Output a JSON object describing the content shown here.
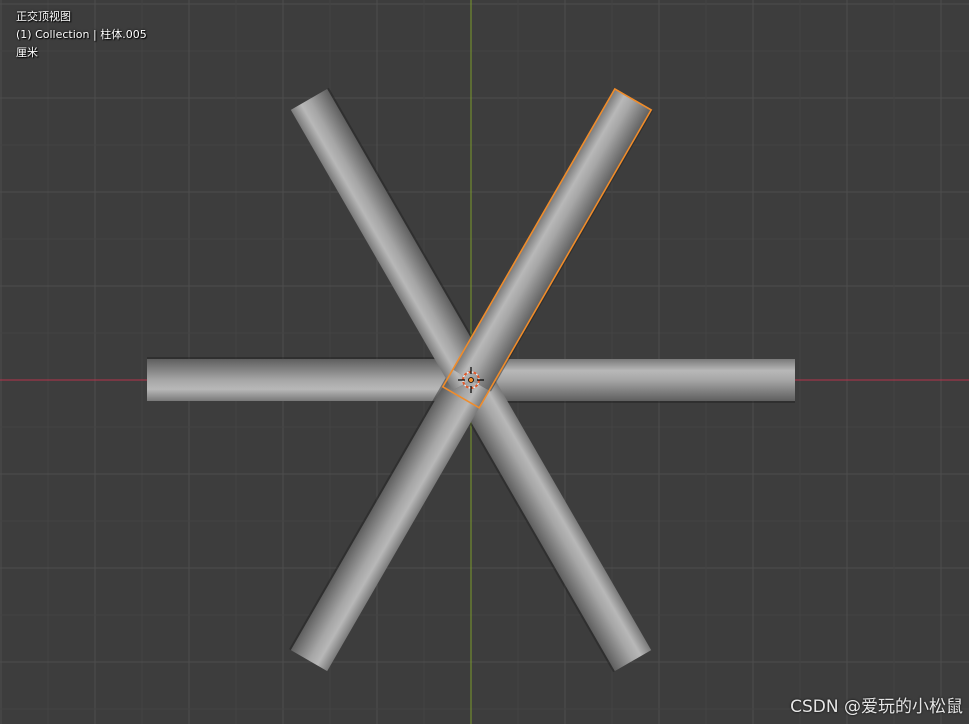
{
  "viewport": {
    "view_name": "正交顶视图",
    "collection_label": "(1) Collection",
    "separator": "|",
    "active_object": "柱体.005",
    "unit": "厘米"
  },
  "watermark": "CSDN @爱玩的小松鼠",
  "colors": {
    "background": "#3d3d3d",
    "grid_minor": "#444444",
    "grid_major": "#4d4d4d",
    "x_axis": "#b5344a",
    "y_axis": "#7b9a2a",
    "cylinder": "#9a9a9a",
    "selection_outline": "#f08c2a"
  },
  "icons": {
    "origin_marker": "3d-cursor-icon"
  }
}
